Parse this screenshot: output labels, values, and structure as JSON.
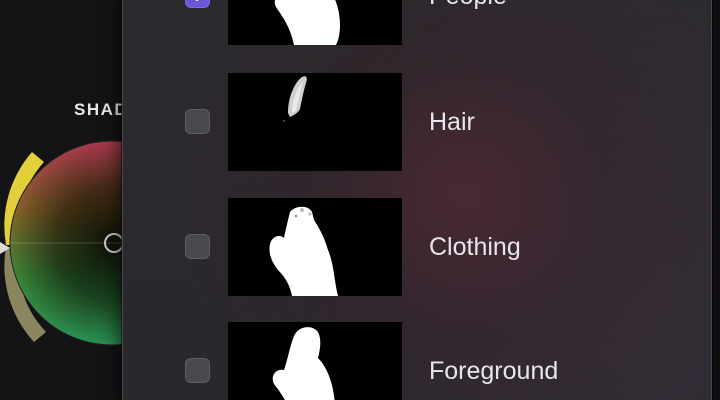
{
  "color_wheel": {
    "title": "SHAD",
    "icons": [
      "color-wheel-icon",
      "wheel-center-puck-icon",
      "saturation-slider-icon",
      "brightness-slider-icon"
    ]
  },
  "mask_panel": {
    "items": [
      {
        "label": "People",
        "checked": true,
        "checkbox_icon": "checkmark-icon",
        "thumbnail": "people-mask-thumbnail"
      },
      {
        "label": "Hair",
        "checked": false,
        "thumbnail": "hair-mask-thumbnail"
      },
      {
        "label": "Clothing",
        "checked": false,
        "thumbnail": "clothing-mask-thumbnail"
      },
      {
        "label": "Foreground",
        "checked": false,
        "thumbnail": "foreground-mask-thumbnail"
      }
    ]
  },
  "colors": {
    "checkbox_checked": "#6b55d8",
    "checkbox_unchecked": "#4b484d",
    "label_text": "#e8e6ea",
    "saturation_slider": "#e6d33c",
    "brightness_slider": "#8d8860"
  }
}
